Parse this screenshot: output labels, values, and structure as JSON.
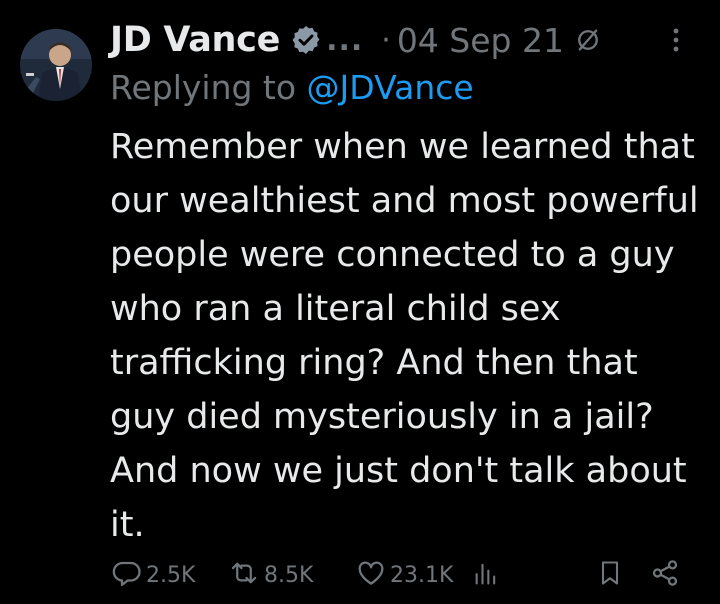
{
  "tweet": {
    "author_name": "JD Vance",
    "truncation": "...",
    "separator": "·",
    "date": "04 Sep 21",
    "replying_to_prefix": "Replying to ",
    "replying_to_handle": "@JDVance",
    "text": "Remember when we learned that our wealthiest and most powerful people were connected to a guy who ran a literal child sex trafficking ring? And then that guy died mysteriously in a jail? And now we just don't talk about it."
  },
  "actions": {
    "replies": "2.5K",
    "reposts": "8.5K",
    "likes": "23.1K"
  },
  "icons": {
    "verified": "verified-badge-icon",
    "visibility": "visibility-icon",
    "more": "more-options-icon",
    "reply": "reply-icon",
    "repost": "repost-icon",
    "like": "heart-icon",
    "views": "views-chart-icon",
    "bookmark": "bookmark-icon",
    "share": "share-icon"
  },
  "colors": {
    "background": "#000000",
    "text_primary": "#e7e9ea",
    "text_secondary": "#71767b",
    "link": "#1d9bf0"
  }
}
